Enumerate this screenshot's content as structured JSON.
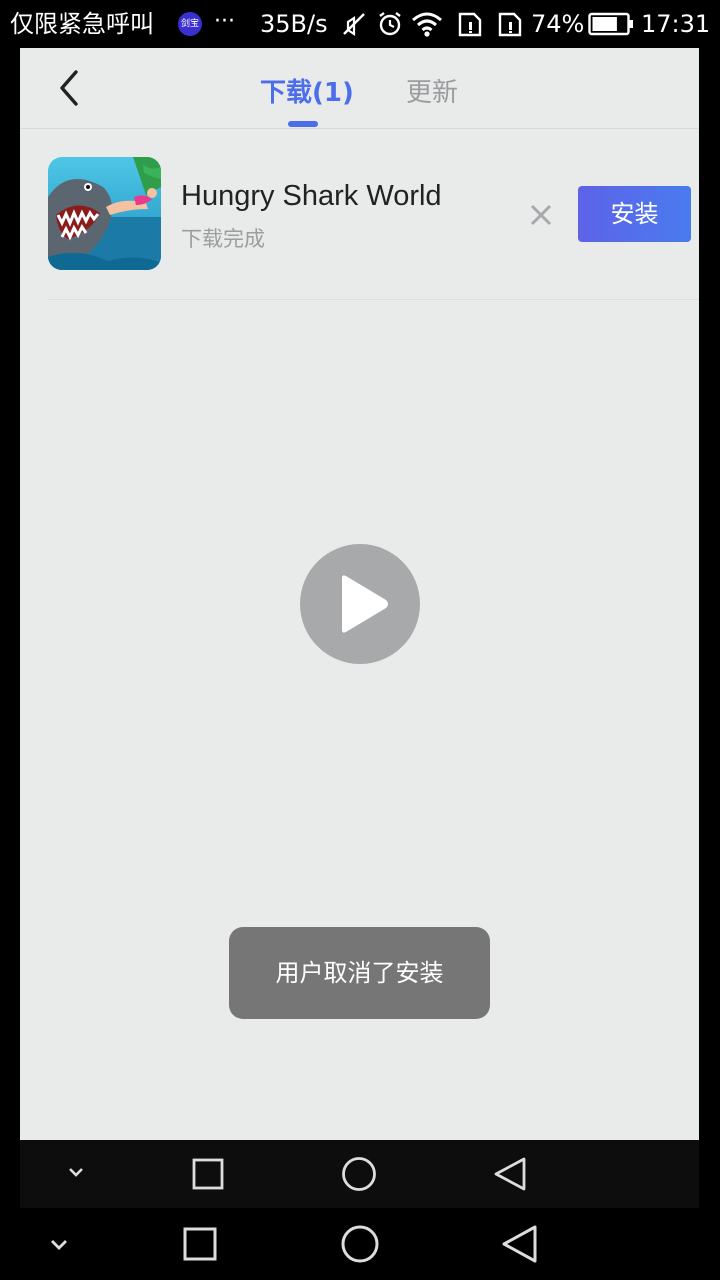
{
  "status_bar": {
    "carrier": "仅限紧急呼叫",
    "app_badge": "剑宝",
    "more": "···",
    "net_speed": "35B/s",
    "battery_percent": "74%",
    "battery_level": 0.74,
    "time": "17:31",
    "icons": [
      "mute-icon",
      "alarm-icon",
      "wifi-icon",
      "sim1-icon",
      "sim2-icon",
      "battery-icon"
    ]
  },
  "header": {
    "back_icon": "chevron-left-icon",
    "tabs": [
      {
        "label": "下载(1)",
        "active": true
      },
      {
        "label": "更新",
        "active": false
      }
    ]
  },
  "downloads": [
    {
      "name": "Hungry Shark World",
      "status": "下载完成",
      "remove_icon": "close-icon",
      "action_label": "安装"
    }
  ],
  "media": {
    "play_icon": "play-icon"
  },
  "toast": {
    "message": "用户取消了安装"
  },
  "nav_bar": {
    "buttons": [
      "hide-chevron-icon",
      "recents-square-icon",
      "home-circle-icon",
      "back-triangle-icon"
    ]
  },
  "colors": {
    "accent": "#4d6eea",
    "background": "#e9eaea",
    "install_gradient_start": "#5d63e9",
    "install_gradient_end": "#4a7bee",
    "toast_bg": "#767676"
  }
}
